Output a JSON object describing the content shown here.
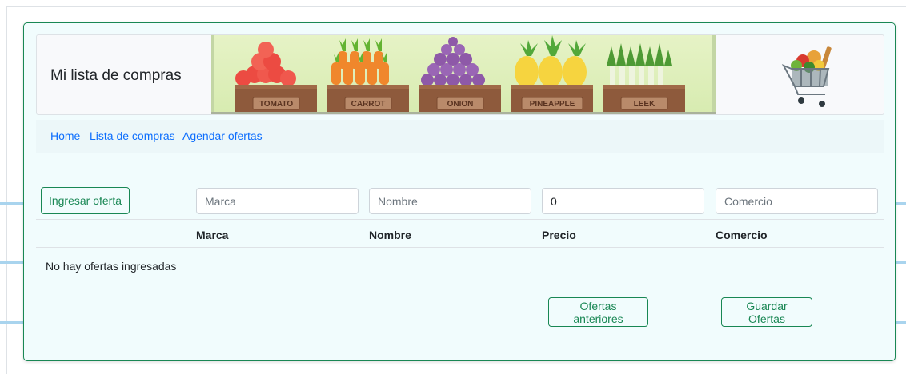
{
  "banner": {
    "title": "Mi lista de compras",
    "crates": [
      "TOMATO",
      "CARROT",
      "ONION",
      "PINEAPPLE",
      "LEEK"
    ]
  },
  "nav": {
    "links": [
      "Home",
      "Lista de compras",
      "Agendar ofertas"
    ]
  },
  "form": {
    "add_button": "Ingresar oferta",
    "marca_placeholder": "Marca",
    "nombre_placeholder": "Nombre",
    "precio_value": "0",
    "comercio_placeholder": "Comercio"
  },
  "table": {
    "headers": [
      "Marca",
      "Nombre",
      "Precio",
      "Comercio"
    ],
    "empty_message": "No hay ofertas ingresadas"
  },
  "actions": {
    "previous_button": "Ofertas anteriores",
    "save_button": "Guardar Ofertas"
  },
  "colors": {
    "accent": "#198754",
    "link": "#0d6efd",
    "card_bg": "#f1fcfd"
  }
}
